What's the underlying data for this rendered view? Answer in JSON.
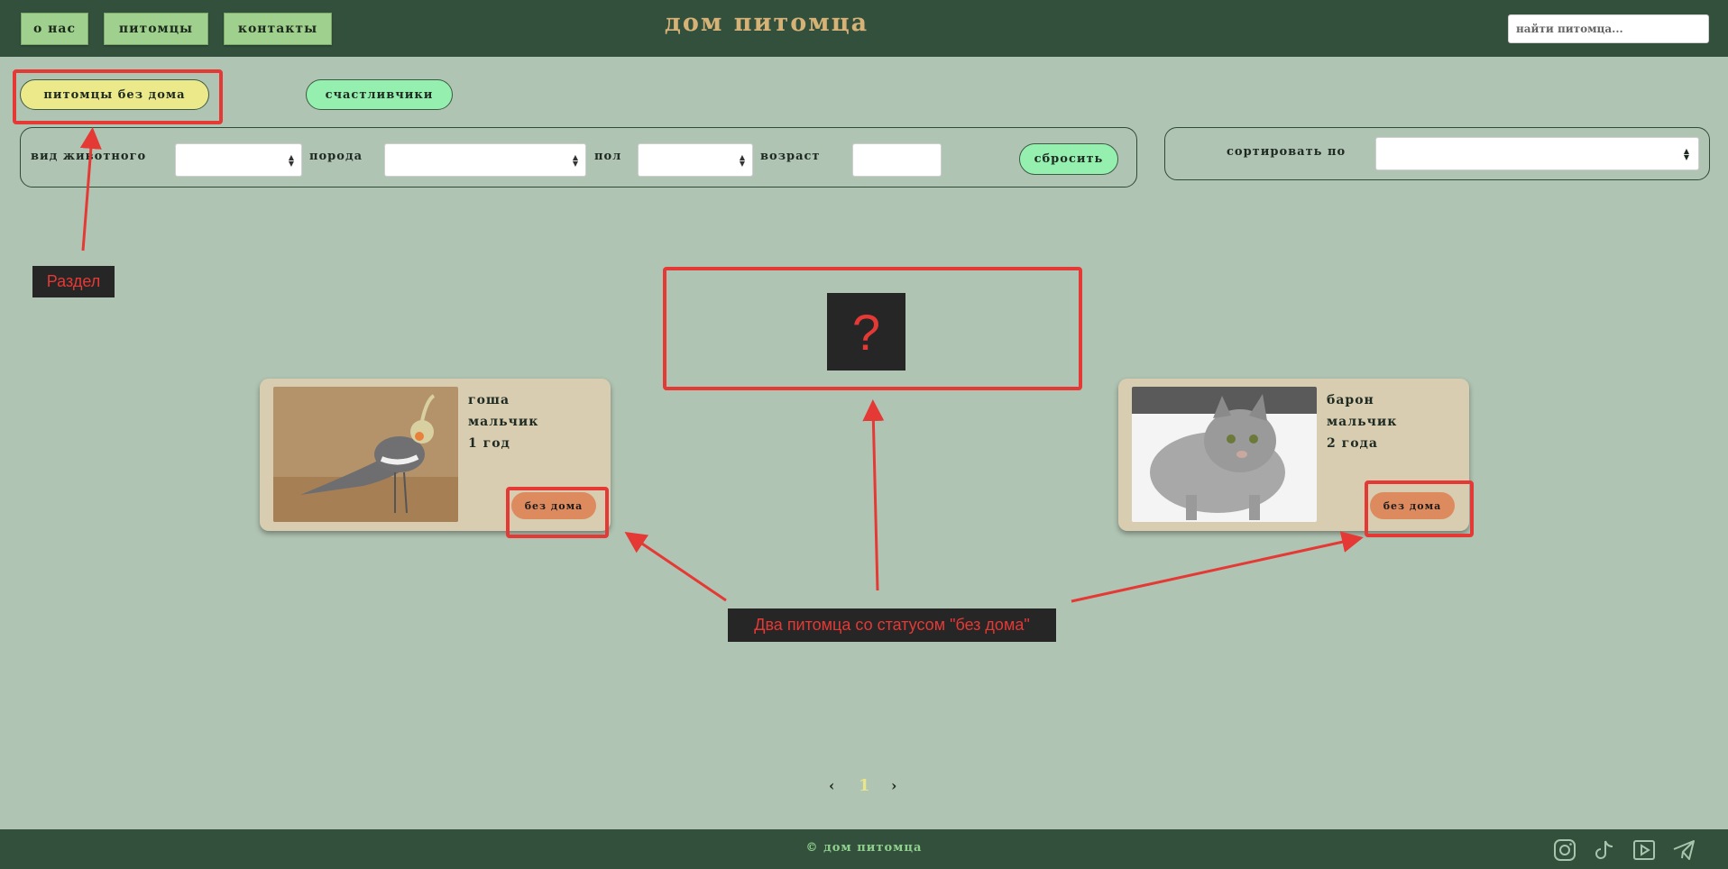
{
  "header": {
    "nav": [
      "о нас",
      "питомцы",
      "контакты"
    ],
    "title": "дом питомца",
    "search_placeholder": "найти питомца..."
  },
  "tabs": {
    "homeless": "питомцы без дома",
    "lucky": "счастливчики"
  },
  "filters": {
    "species_label": "вид животного",
    "breed_label": "порода",
    "sex_label": "пол",
    "age_label": "возраст",
    "reset_label": "сбросить",
    "sort_label": "сортировать по"
  },
  "pets": [
    {
      "name": "гоша",
      "sex": "мальчик",
      "age": "1 год",
      "status": "без дома"
    },
    {
      "name": "барон",
      "sex": "мальчик",
      "age": "2 года",
      "status": "без дома"
    }
  ],
  "pagination": {
    "prev": "‹",
    "current": "1",
    "next": "›"
  },
  "footer": {
    "copyright": "© дом питомца",
    "social_icons": [
      "instagram-icon",
      "tiktok-icon",
      "youtube-icon",
      "telegram-icon"
    ]
  },
  "annotations": {
    "section_note": "Раздел",
    "question_mark": "?",
    "pets_note": "Два питомца со статусом \"без дома\""
  },
  "colors": {
    "background": "#b0c4b3",
    "header": "#33503d",
    "title": "#d6b277",
    "nav_button": "#9fd08d",
    "tab_active": "#ebe98a",
    "tab_inactive": "#95f0b0",
    "card": "#d8cdb0",
    "status_button": "#de8a5f",
    "annotation_red": "#e53935"
  }
}
